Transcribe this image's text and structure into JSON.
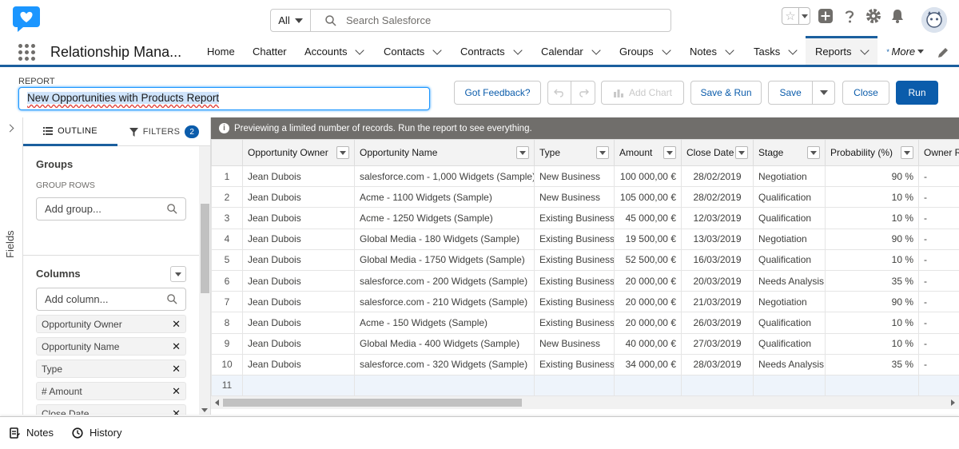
{
  "header": {
    "search_scope": "All",
    "search_placeholder": "Search Salesforce"
  },
  "nav": {
    "app_name": "Relationship Mana...",
    "items": [
      "Home",
      "Chatter",
      "Accounts",
      "Contacts",
      "Contracts",
      "Calendar",
      "Groups",
      "Notes",
      "Tasks",
      "Reports"
    ],
    "more": "More",
    "active": "Reports"
  },
  "report": {
    "label": "REPORT",
    "name": "New Opportunities with Products Report",
    "buttons": {
      "feedback": "Got Feedback?",
      "add_chart": "Add Chart",
      "save_run": "Save & Run",
      "save": "Save",
      "close": "Close",
      "run": "Run"
    }
  },
  "side": {
    "fields_label": "Fields",
    "tab_outline": "OUTLINE",
    "tab_filters": "FILTERS",
    "filters_count": "2",
    "groups_title": "Groups",
    "group_rows_label": "GROUP ROWS",
    "add_group_placeholder": "Add group...",
    "columns_title": "Columns",
    "add_column_placeholder": "Add column...",
    "columns": [
      "Opportunity Owner",
      "Opportunity Name",
      "Type",
      "# Amount",
      "Close Date"
    ]
  },
  "grid": {
    "preview_text": "Previewing a limited number of records. Run the report to see everything.",
    "headers": [
      "Opportunity Owner",
      "Opportunity Name",
      "Type",
      "Amount",
      "Close Date",
      "Stage",
      "Probability (%)",
      "Owner R"
    ],
    "rows": [
      [
        "1",
        "Jean Dubois",
        "salesforce.com - 1,000 Widgets (Sample)",
        "New Business",
        "100 000,00 €",
        "28/02/2019",
        "Negotiation",
        "90 %",
        "-"
      ],
      [
        "2",
        "Jean Dubois",
        "Acme - 1100 Widgets (Sample)",
        "New Business",
        "105 000,00 €",
        "28/02/2019",
        "Qualification",
        "10 %",
        "-"
      ],
      [
        "3",
        "Jean Dubois",
        "Acme - 1250 Widgets (Sample)",
        "Existing Business",
        "45 000,00 €",
        "12/03/2019",
        "Qualification",
        "10 %",
        "-"
      ],
      [
        "4",
        "Jean Dubois",
        "Global Media - 180 Widgets (Sample)",
        "Existing Business",
        "19 500,00 €",
        "13/03/2019",
        "Negotiation",
        "90 %",
        "-"
      ],
      [
        "5",
        "Jean Dubois",
        "Global Media - 1750 Widgets (Sample)",
        "Existing Business",
        "52 500,00 €",
        "16/03/2019",
        "Qualification",
        "10 %",
        "-"
      ],
      [
        "6",
        "Jean Dubois",
        "salesforce.com - 200 Widgets (Sample)",
        "Existing Business",
        "20 000,00 €",
        "20/03/2019",
        "Needs Analysis",
        "35 %",
        "-"
      ],
      [
        "7",
        "Jean Dubois",
        "salesforce.com - 210 Widgets (Sample)",
        "Existing Business",
        "20 000,00 €",
        "21/03/2019",
        "Negotiation",
        "90 %",
        "-"
      ],
      [
        "8",
        "Jean Dubois",
        "Acme - 150 Widgets (Sample)",
        "Existing Business",
        "20 000,00 €",
        "26/03/2019",
        "Qualification",
        "10 %",
        "-"
      ],
      [
        "9",
        "Jean Dubois",
        "Global Media - 400 Widgets (Sample)",
        "New Business",
        "40 000,00 €",
        "27/03/2019",
        "Qualification",
        "10 %",
        "-"
      ],
      [
        "10",
        "Jean Dubois",
        "salesforce.com - 320 Widgets (Sample)",
        "Existing Business",
        "34 000,00 €",
        "28/03/2019",
        "Needs Analysis",
        "35 %",
        "-"
      ],
      [
        "11",
        "",
        "",
        "",
        "",
        "",
        "",
        "",
        ""
      ]
    ]
  },
  "footer": {
    "notes": "Notes",
    "history": "History"
  },
  "colors": {
    "brand": "#0b5cab",
    "logo": "#1b96ff",
    "nav_accent": "#1b5f9e",
    "banner": "#706e6b"
  }
}
